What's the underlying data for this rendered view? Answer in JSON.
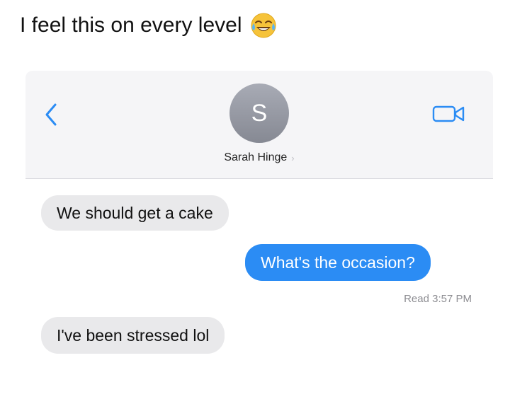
{
  "caption": {
    "text": "I feel this on every level",
    "emoji_icon": "tears-of-joy-emoji-icon"
  },
  "header": {
    "back_icon": "chevron-left-icon",
    "avatar_initial": "S",
    "contact_name": "Sarah Hinge",
    "video_icon": "video-camera-icon",
    "background_color": "#f5f5f7"
  },
  "messages": [
    {
      "direction": "incoming",
      "text": "We should get a cake"
    },
    {
      "direction": "outgoing",
      "text": "What's the occasion?"
    },
    {
      "direction": "incoming",
      "text": "I've been stressed lol"
    }
  ],
  "read_receipt": {
    "label": "Read",
    "time": "3:57 PM"
  },
  "colors": {
    "outgoing_bubble": "#2b8cf4",
    "incoming_bubble": "#e9e9eb",
    "accent": "#2b8cf4"
  }
}
